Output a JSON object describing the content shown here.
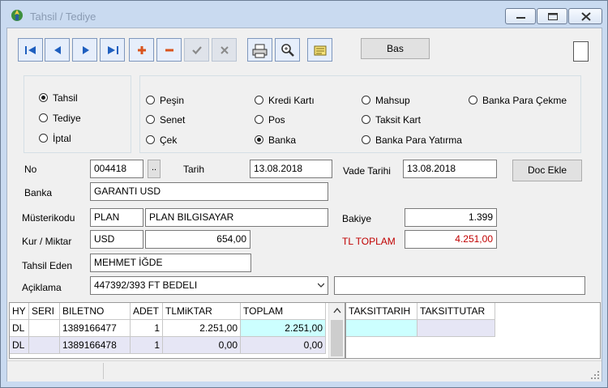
{
  "window": {
    "title": "Tahsil / Tediye"
  },
  "toolbar": {
    "buttons": [
      {
        "name": "first-record-icon",
        "icon": "first"
      },
      {
        "name": "previous-record-icon",
        "icon": "prev"
      },
      {
        "name": "next-record-icon",
        "icon": "next"
      },
      {
        "name": "last-record-icon",
        "icon": "last"
      },
      {
        "name": "add-record-icon",
        "icon": "plus"
      },
      {
        "name": "delete-record-icon",
        "icon": "minus"
      },
      {
        "name": "confirm-icon",
        "icon": "check"
      },
      {
        "name": "cancel-icon",
        "icon": "x"
      },
      {
        "name": "print-icon",
        "icon": "printer"
      },
      {
        "name": "zoom-search-icon",
        "icon": "magnifier"
      },
      {
        "name": "notes-icon",
        "icon": "notes"
      }
    ],
    "bas_label": "Bas"
  },
  "type_radios": [
    {
      "label": "Tahsil",
      "checked": true
    },
    {
      "label": "Tediye",
      "checked": false
    },
    {
      "label": "İptal",
      "checked": false
    }
  ],
  "payment_radios": [
    {
      "label": "Peşin",
      "checked": false
    },
    {
      "label": "Senet",
      "checked": false
    },
    {
      "label": "Çek",
      "checked": false
    },
    {
      "label": "Kredi Kartı",
      "checked": false
    },
    {
      "label": "Pos",
      "checked": false
    },
    {
      "label": "Banka",
      "checked": true
    },
    {
      "label": "Mahsup",
      "checked": false
    },
    {
      "label": "Taksit Kart",
      "checked": false
    },
    {
      "label": "Banka Para Yatırma",
      "checked": false
    },
    {
      "label": "Banka Para Çekme",
      "checked": false
    }
  ],
  "form": {
    "no_label": "No",
    "no_value": "004418",
    "no_lookup": "..",
    "tarih_label": "Tarih",
    "tarih_value": "13.08.2018",
    "vade_label": "Vade Tarihi",
    "vade_value": "13.08.2018",
    "doc_ekle": "Doc Ekle",
    "banka_label": "Banka",
    "banka_value": "GARANTI USD",
    "musteri_label": "Müsterikodu",
    "musteri_code": "PLAN",
    "musteri_name": "PLAN BILGISAYAR",
    "bakiye_label": "Bakiye",
    "bakiye_value": "1.399",
    "kur_label": "Kur / Miktar",
    "kur_value": "USD",
    "miktar_value": "654,00",
    "tl_toplam_label": "TL TOPLAM",
    "tl_toplam_value": "4.251,00",
    "tahsil_eden_label": "Tahsil Eden",
    "tahsil_eden_value": "MEHMET İĞDE",
    "aciklama_label": "Açiklama",
    "aciklama_value": "447392/393 FT BEDELI",
    "aciklama_extra": ""
  },
  "grid": {
    "columns": [
      "HY",
      "SERI",
      "BILETNO",
      "ADET",
      "TLMiKTAR",
      "TOPLAM"
    ],
    "rows": [
      [
        "DL",
        "",
        "1389166477",
        "1",
        "2.251,00",
        "2.251,00"
      ],
      [
        "DL",
        "",
        "1389166478",
        "1",
        "0,00",
        "0,00"
      ]
    ]
  },
  "grid2": {
    "columns": [
      "TAKSITTARIH",
      "TAKSITTUTAR"
    ]
  },
  "colors": {
    "red_label": "#c00000",
    "highlight_cyan": "#ccffff",
    "row_lavender": "#e6e6f5"
  }
}
